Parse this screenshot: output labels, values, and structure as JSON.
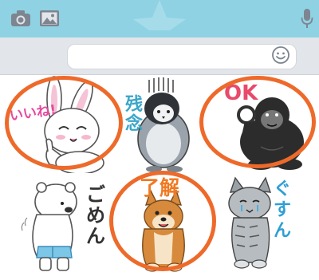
{
  "header": {
    "bg": "#8fd2e3"
  },
  "toolbar": {
    "camera_icon": "camera-icon",
    "image_icon": "image-icon",
    "message_placeholder": "",
    "emoji_icon": "emoji-icon",
    "mic_icon": "microphone-icon"
  },
  "stickers": [
    {
      "character": "rabbit",
      "text": "いいね!",
      "text_color": "#e64aa0",
      "selected": true
    },
    {
      "character": "penguin",
      "text": "残念",
      "text_color": "#3aa6c8",
      "selected": false
    },
    {
      "character": "gorilla",
      "text": "OK",
      "text_color": "#e84a6a",
      "selected": true
    },
    {
      "character": "polar-bear",
      "text": "ごめん",
      "text_color": "#333333",
      "selected": false
    },
    {
      "character": "shiba-dog",
      "text": "了解",
      "text_color": "#f07a22",
      "selected": true
    },
    {
      "character": "tabby-cat",
      "text": "ぐすん",
      "text_color": "#2f9fd4",
      "selected": false
    }
  ],
  "colors": {
    "highlight": "#ee6a2a"
  }
}
